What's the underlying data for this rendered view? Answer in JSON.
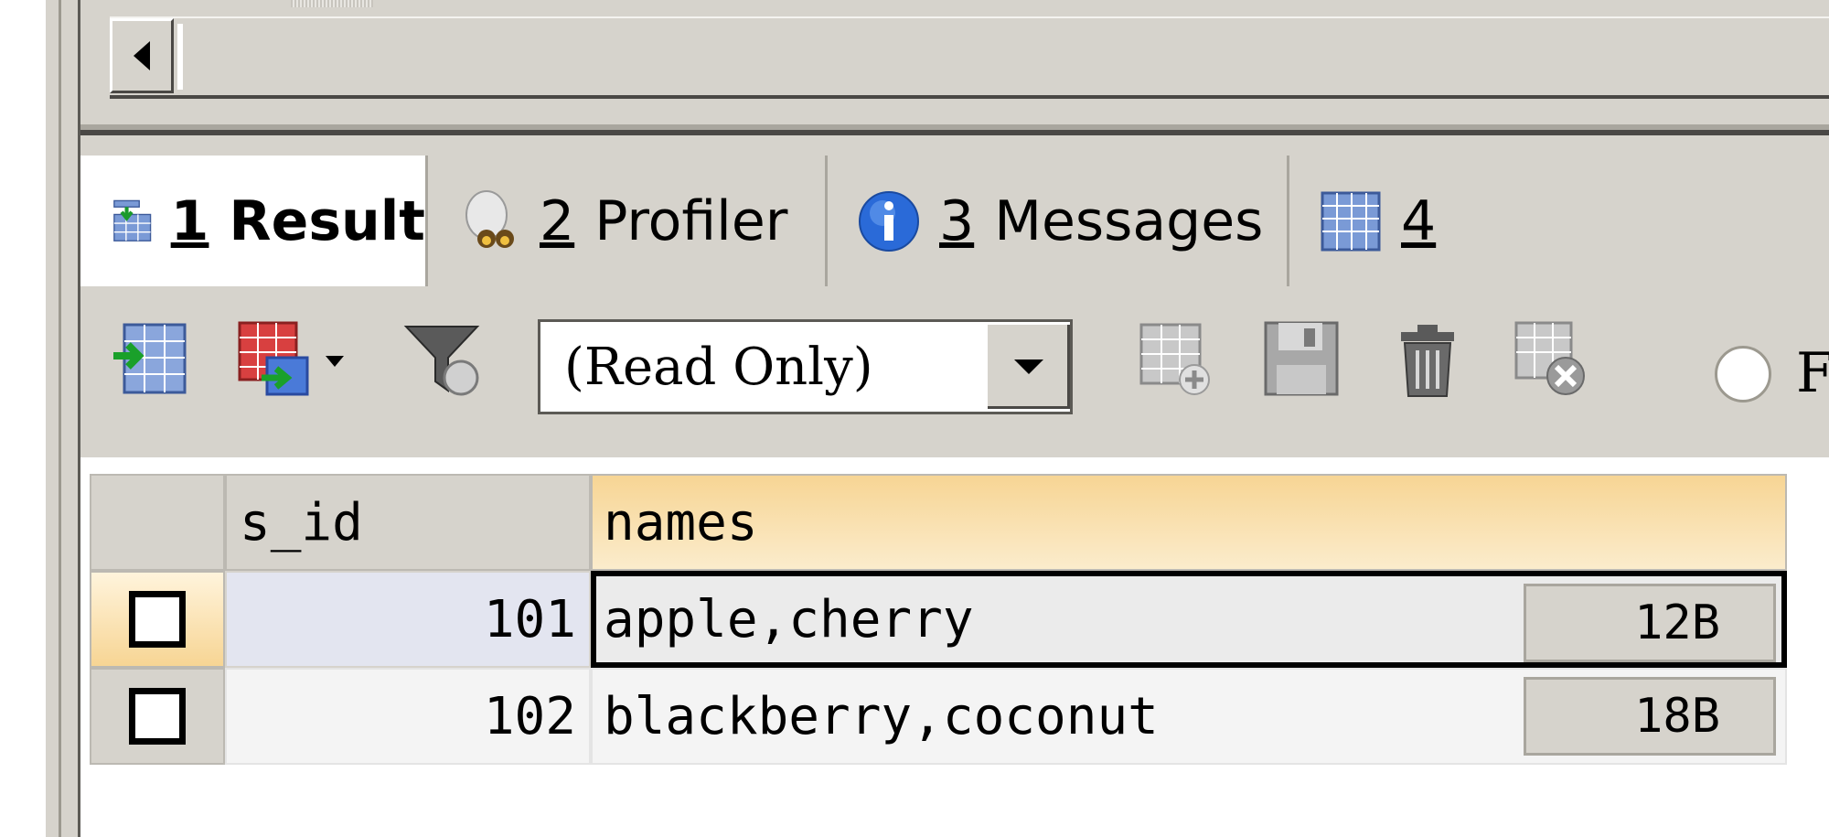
{
  "tabs": [
    {
      "num": "1",
      "label": "Result",
      "icon": "result-grid-icon",
      "active": true
    },
    {
      "num": "2",
      "label": "Profiler",
      "icon": "profiler-binoculars-icon",
      "active": false
    },
    {
      "num": "3",
      "label": "Messages",
      "icon": "info-icon",
      "active": false
    },
    {
      "num": "4",
      "label": "",
      "icon": "table-grid-icon",
      "active": false
    }
  ],
  "toolbar": {
    "mode_select": {
      "value": "(Read Only)"
    },
    "radio_partial_label": "F",
    "icons": [
      "import-grid-icon",
      "export-grid-icon",
      "filter-icon",
      "add-row-icon",
      "save-icon",
      "delete-icon",
      "cancel-changes-icon"
    ]
  },
  "grid": {
    "columns": [
      "s_id",
      "names"
    ],
    "rows": [
      {
        "s_id": "101",
        "names": "apple,cherry",
        "size": "12B"
      },
      {
        "s_id": "102",
        "names": "blackberry,coconut",
        "size": "18B"
      }
    ]
  },
  "colors": {
    "header_highlight": "#f7d594",
    "chrome": "#d6d3cc",
    "selected_row": "#e3e5f0"
  }
}
